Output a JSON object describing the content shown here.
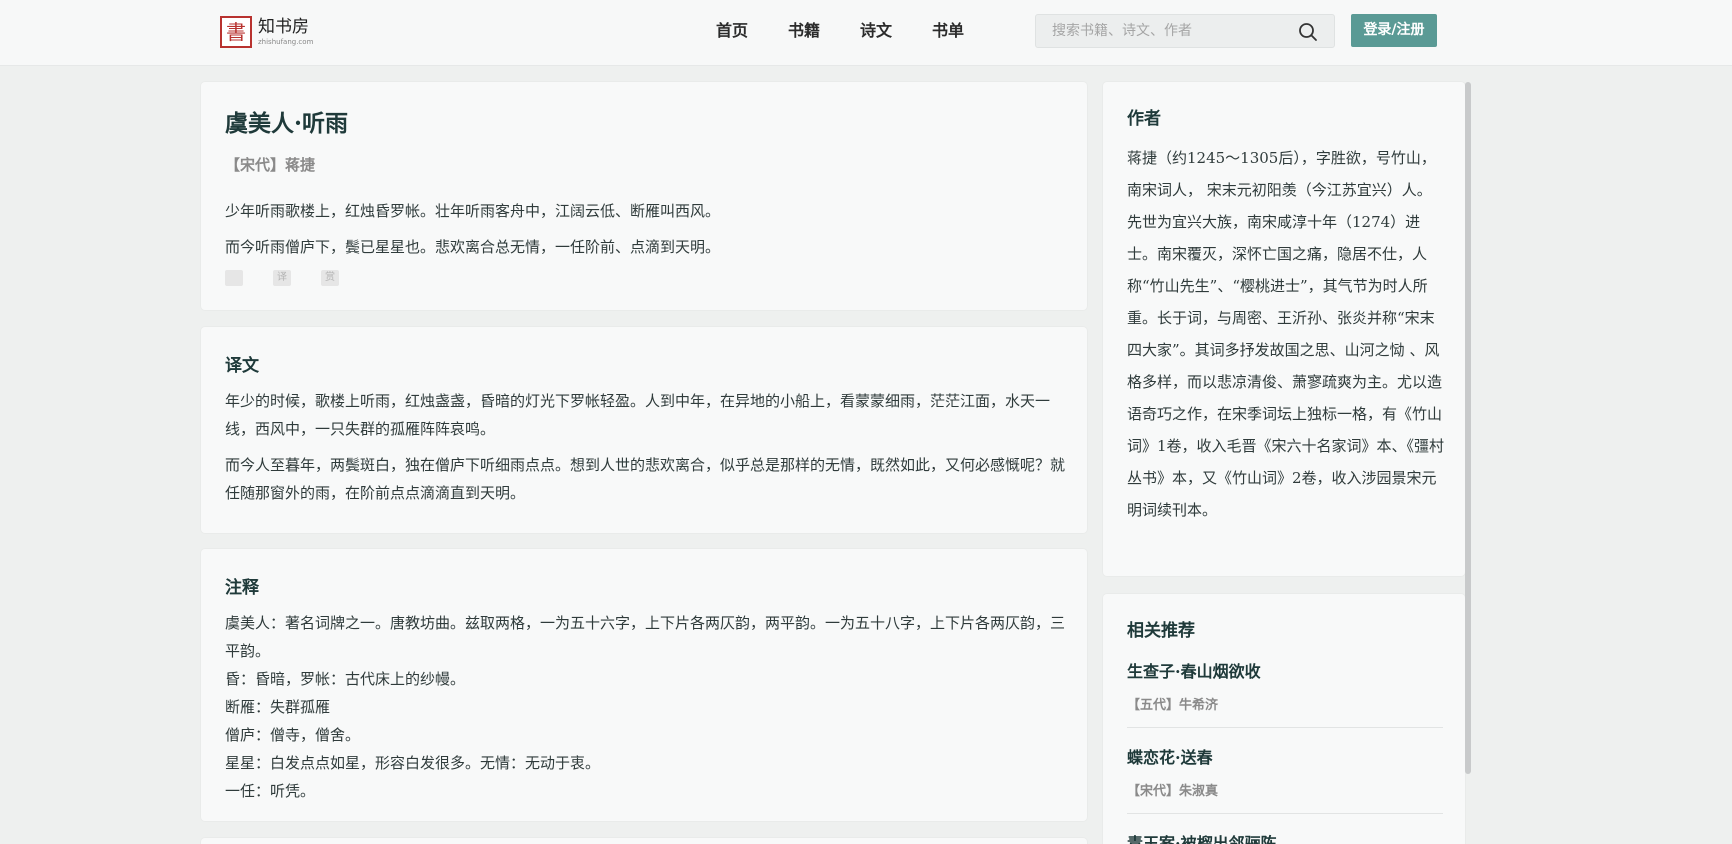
{
  "header": {
    "logo_mark": "書",
    "logo_title": "知书房",
    "logo_sub": "zhishufang.com",
    "nav": [
      "首页",
      "书籍",
      "诗文",
      "书单"
    ],
    "search_placeholder": "搜索书籍、诗文、作者",
    "login_label": "登录/注册",
    "colors": {
      "accent": "#5a9a95",
      "logo_red": "#b8322f"
    }
  },
  "poem": {
    "title": "虞美人·听雨",
    "author": "【宋代】蒋捷",
    "lines": [
      "少年听雨歌楼上，红烛昏罗帐。壮年听雨客舟中，江阔云低、断雁叫西风。",
      "而今听雨僧庐下，鬓已星星也。悲欢离合总无情，一任阶前、点滴到天明。"
    ],
    "tools": [
      "copy-icon",
      "translate-icon",
      "appreciate-icon"
    ],
    "tool_labels": [
      "",
      "译",
      "赏"
    ]
  },
  "translation": {
    "title": "译文",
    "paragraphs": [
      "年少的时候，歌楼上听雨，红烛盏盏，昏暗的灯光下罗帐轻盈。人到中年，在异地的小船上，看蒙蒙细雨，茫茫江面，水天一线，西风中，一只失群的孤雁阵阵哀鸣。",
      "而今人至暮年，两鬓斑白，独在僧庐下听细雨点点。想到人世的悲欢离合，似乎总是那样的无情，既然如此，又何必感慨呢？就任随那窗外的雨，在阶前点点滴滴直到天明。"
    ]
  },
  "notes": {
    "title": "注释",
    "lines": [
      "虞美人：著名词牌之一。唐教坊曲。兹取两格，一为五十六字，上下片各两仄韵，两平韵。一为五十八字，上下片各两仄韵，三平韵。",
      "昏：昏暗，罗帐：古代床上的纱幔。",
      "断雁：失群孤雁",
      "僧庐：僧寺，僧舍。",
      "星星：白发点点如星，形容白发很多。无情：无动于衷。",
      "一任：听凭。"
    ]
  },
  "sidebar": {
    "author_title": "作者",
    "author_bio": "蒋捷（约1245～1305后），字胜欲，号竹山，南宋词人， 宋末元初阳羡（今江苏宜兴）人。先世为宜兴大族，南宋咸淳十年（1274）进士。南宋覆灭，深怀亡国之痛，隐居不仕，人称“竹山先生”、“樱桃进士”，其气节为时人所重。长于词，与周密、王沂孙、张炎并称“宋末四大家”。其词多抒发故国之思、山河之恸 、风格多样，而以悲凉清俊、萧寥疏爽为主。尤以造语奇巧之作，在宋季词坛上独标一格，有《竹山词》1卷，收入毛晋《宋六十名家词》本、《彊村丛书》本，又《竹山词》2卷，收入涉园景宋元明词续刊本。",
    "rec_title": "相关推荐",
    "recommendations": [
      {
        "title": "生查子·春山烟欲收",
        "author": "【五代】牛希济"
      },
      {
        "title": "蝶恋花·送春",
        "author": "【宋代】朱淑真"
      },
      {
        "title": "青玉案·被榴出邻骊陈",
        "author": ""
      }
    ]
  }
}
